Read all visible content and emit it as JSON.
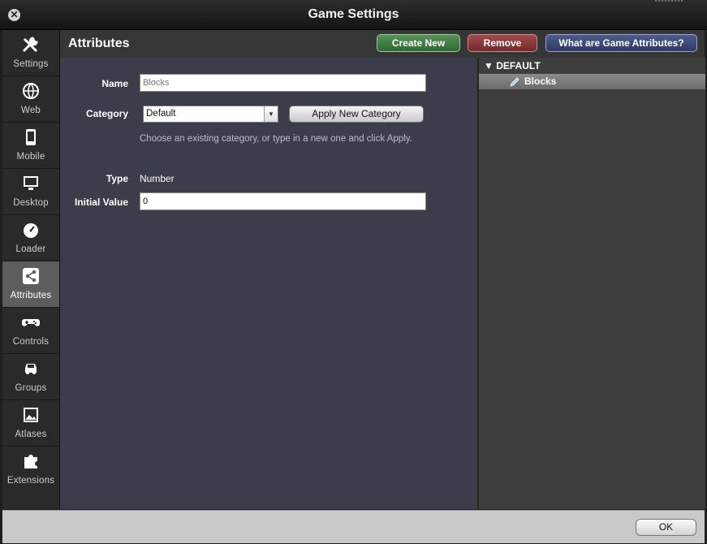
{
  "window": {
    "title": "Game Settings"
  },
  "sidebar": {
    "items": [
      {
        "label": "Settings",
        "icon": "wrench-icon"
      },
      {
        "label": "Web",
        "icon": "globe-icon"
      },
      {
        "label": "Mobile",
        "icon": "phone-icon"
      },
      {
        "label": "Desktop",
        "icon": "monitor-icon"
      },
      {
        "label": "Loader",
        "icon": "gauge-icon"
      },
      {
        "label": "Attributes",
        "icon": "share-icon",
        "active": true
      },
      {
        "label": "Controls",
        "icon": "gamepad-icon"
      },
      {
        "label": "Groups",
        "icon": "car-icon"
      },
      {
        "label": "Atlases",
        "icon": "image-icon"
      },
      {
        "label": "Extensions",
        "icon": "puzzle-icon"
      }
    ]
  },
  "header": {
    "title": "Attributes",
    "create_label": "Create New",
    "remove_label": "Remove",
    "help_label": "What are Game Attributes?"
  },
  "form": {
    "name_label": "Name",
    "name_placeholder": "Blocks",
    "category_label": "Category",
    "category_value": "Default",
    "apply_label": "Apply New Category",
    "hint": "Choose an existing category, or type in a new one and click Apply.",
    "type_label": "Type",
    "type_value": "Number",
    "initial_label": "Initial Value",
    "initial_value": "0"
  },
  "tree": {
    "group_label": "▼ DEFAULT",
    "item_label": "Blocks"
  },
  "footer": {
    "ok_label": "OK"
  },
  "colors": {
    "accent_green": "#2e6a31",
    "accent_red": "#762929",
    "accent_blue": "#2e3b66",
    "form_bg": "#3c3d4a"
  }
}
